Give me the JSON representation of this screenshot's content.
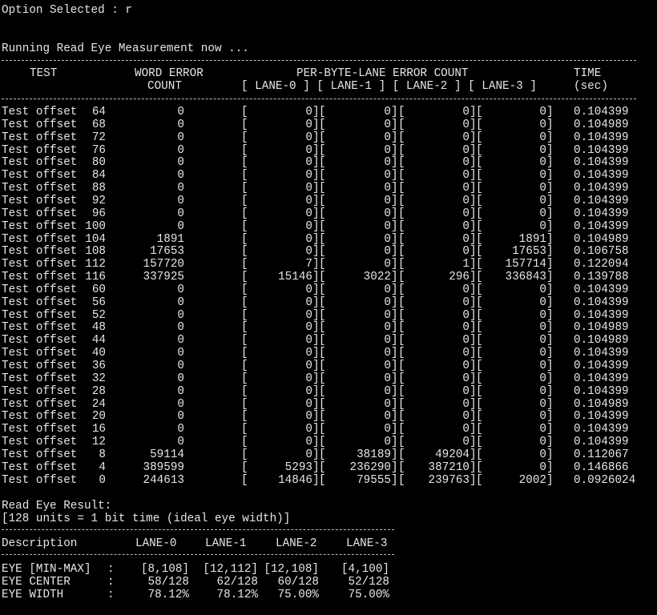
{
  "console": {
    "option_line": "Option Selected : r",
    "running_line": "Running Read Eye Measurement now ..."
  },
  "table": {
    "headers": {
      "test": "TEST",
      "word_error_1": "WORD ERROR",
      "word_error_2": "COUNT",
      "per_byte_1": "PER-BYTE-LANE ERROR COUNT",
      "per_byte_2": "[ LANE-0 ] [ LANE-1 ] [ LANE-2 ] [ LANE-3 ]",
      "time_1": "TIME",
      "time_2": "(sec)"
    },
    "rows": [
      {
        "label": "Test offset",
        "offset": "64",
        "word": "0",
        "l0": "0",
        "l1": "0",
        "l2": "0",
        "l3": "0",
        "time": "0.104399"
      },
      {
        "label": "Test offset",
        "offset": "68",
        "word": "0",
        "l0": "0",
        "l1": "0",
        "l2": "0",
        "l3": "0",
        "time": "0.104989"
      },
      {
        "label": "Test offset",
        "offset": "72",
        "word": "0",
        "l0": "0",
        "l1": "0",
        "l2": "0",
        "l3": "0",
        "time": "0.104399"
      },
      {
        "label": "Test offset",
        "offset": "76",
        "word": "0",
        "l0": "0",
        "l1": "0",
        "l2": "0",
        "l3": "0",
        "time": "0.104399"
      },
      {
        "label": "Test offset",
        "offset": "80",
        "word": "0",
        "l0": "0",
        "l1": "0",
        "l2": "0",
        "l3": "0",
        "time": "0.104399"
      },
      {
        "label": "Test offset",
        "offset": "84",
        "word": "0",
        "l0": "0",
        "l1": "0",
        "l2": "0",
        "l3": "0",
        "time": "0.104399"
      },
      {
        "label": "Test offset",
        "offset": "88",
        "word": "0",
        "l0": "0",
        "l1": "0",
        "l2": "0",
        "l3": "0",
        "time": "0.104399"
      },
      {
        "label": "Test offset",
        "offset": "92",
        "word": "0",
        "l0": "0",
        "l1": "0",
        "l2": "0",
        "l3": "0",
        "time": "0.104399"
      },
      {
        "label": "Test offset",
        "offset": "96",
        "word": "0",
        "l0": "0",
        "l1": "0",
        "l2": "0",
        "l3": "0",
        "time": "0.104399"
      },
      {
        "label": "Test offset",
        "offset": "100",
        "word": "0",
        "l0": "0",
        "l1": "0",
        "l2": "0",
        "l3": "0",
        "time": "0.104399"
      },
      {
        "label": "Test offset",
        "offset": "104",
        "word": "1891",
        "l0": "0",
        "l1": "0",
        "l2": "0",
        "l3": "1891",
        "time": "0.104989"
      },
      {
        "label": "Test offset",
        "offset": "108",
        "word": "17653",
        "l0": "0",
        "l1": "0",
        "l2": "0",
        "l3": "17653",
        "time": "0.106758"
      },
      {
        "label": "Test offset",
        "offset": "112",
        "word": "157720",
        "l0": "7",
        "l1": "0",
        "l2": "1",
        "l3": "157714",
        "time": "0.122094"
      },
      {
        "label": "Test offset",
        "offset": "116",
        "word": "337925",
        "l0": "15146",
        "l1": "3022",
        "l2": "296",
        "l3": "336843",
        "time": "0.139788"
      },
      {
        "label": "Test offset",
        "offset": "60",
        "word": "0",
        "l0": "0",
        "l1": "0",
        "l2": "0",
        "l3": "0",
        "time": "0.104399"
      },
      {
        "label": "Test offset",
        "offset": "56",
        "word": "0",
        "l0": "0",
        "l1": "0",
        "l2": "0",
        "l3": "0",
        "time": "0.104399"
      },
      {
        "label": "Test offset",
        "offset": "52",
        "word": "0",
        "l0": "0",
        "l1": "0",
        "l2": "0",
        "l3": "0",
        "time": "0.104399"
      },
      {
        "label": "Test offset",
        "offset": "48",
        "word": "0",
        "l0": "0",
        "l1": "0",
        "l2": "0",
        "l3": "0",
        "time": "0.104989"
      },
      {
        "label": "Test offset",
        "offset": "44",
        "word": "0",
        "l0": "0",
        "l1": "0",
        "l2": "0",
        "l3": "0",
        "time": "0.104989"
      },
      {
        "label": "Test offset",
        "offset": "40",
        "word": "0",
        "l0": "0",
        "l1": "0",
        "l2": "0",
        "l3": "0",
        "time": "0.104399"
      },
      {
        "label": "Test offset",
        "offset": "36",
        "word": "0",
        "l0": "0",
        "l1": "0",
        "l2": "0",
        "l3": "0",
        "time": "0.104399"
      },
      {
        "label": "Test offset",
        "offset": "32",
        "word": "0",
        "l0": "0",
        "l1": "0",
        "l2": "0",
        "l3": "0",
        "time": "0.104399"
      },
      {
        "label": "Test offset",
        "offset": "28",
        "word": "0",
        "l0": "0",
        "l1": "0",
        "l2": "0",
        "l3": "0",
        "time": "0.104399"
      },
      {
        "label": "Test offset",
        "offset": "24",
        "word": "0",
        "l0": "0",
        "l1": "0",
        "l2": "0",
        "l3": "0",
        "time": "0.104989"
      },
      {
        "label": "Test offset",
        "offset": "20",
        "word": "0",
        "l0": "0",
        "l1": "0",
        "l2": "0",
        "l3": "0",
        "time": "0.104399"
      },
      {
        "label": "Test offset",
        "offset": "16",
        "word": "0",
        "l0": "0",
        "l1": "0",
        "l2": "0",
        "l3": "0",
        "time": "0.104399"
      },
      {
        "label": "Test offset",
        "offset": "12",
        "word": "0",
        "l0": "0",
        "l1": "0",
        "l2": "0",
        "l3": "0",
        "time": "0.104399"
      },
      {
        "label": "Test offset",
        "offset": "8",
        "word": "59114",
        "l0": "0",
        "l1": "38189",
        "l2": "49204",
        "l3": "0",
        "time": "0.112067"
      },
      {
        "label": "Test offset",
        "offset": "4",
        "word": "389599",
        "l0": "5293",
        "l1": "236290",
        "l2": "387210",
        "l3": "0",
        "time": "0.146866"
      },
      {
        "label": "Test offset",
        "offset": "0",
        "word": "244613",
        "l0": "14846",
        "l1": "79555",
        "l2": "239763",
        "l3": "2002",
        "time": "0.0926024"
      }
    ]
  },
  "result": {
    "title": "Read Eye Result:",
    "note": "[128 units = 1 bit time (ideal eye width)]",
    "headers": {
      "description": "Description",
      "lane0": "LANE-0",
      "lane1": "LANE-1",
      "lane2": "LANE-2",
      "lane3": "LANE-3"
    },
    "rows": [
      {
        "label": "EYE [MIN-MAX]",
        "colon": ":",
        "lane0": "[8,108]",
        "lane1": "[12,112]",
        "lane2": "[12,108]",
        "lane3": "[4,100]"
      },
      {
        "label": "EYE CENTER",
        "colon": ":",
        "lane0": "58/128",
        "lane1": "62/128",
        "lane2": "60/128",
        "lane3": "52/128"
      },
      {
        "label": "EYE WIDTH",
        "colon": ":",
        "lane0": "78.12%",
        "lane1": "78.12%",
        "lane2": "75.00%",
        "lane3": "75.00%"
      }
    ]
  }
}
